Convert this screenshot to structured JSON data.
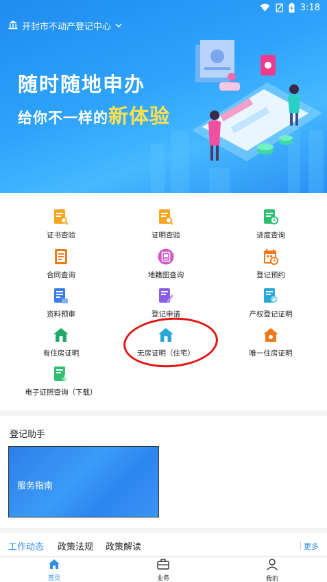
{
  "status_bar": {
    "time": "3:18",
    "icons": [
      "wifi-icon",
      "no-signal-icon",
      "battery-icon"
    ]
  },
  "header": {
    "location": "开封市不动产登记中心"
  },
  "banner": {
    "title_line1": "随时随地申办",
    "title_line2_prefix": "给你不一样的",
    "title_line2_highlight": "新体验"
  },
  "services": [
    {
      "label": "证书查验",
      "icon": "certificate-verify-icon",
      "color": "#f5a623"
    },
    {
      "label": "证明查验",
      "icon": "proof-verify-icon",
      "color": "#f5a623"
    },
    {
      "label": "进度查询",
      "icon": "progress-query-icon",
      "color": "#2fbf71"
    },
    {
      "label": "合同查询",
      "icon": "contract-query-icon",
      "color": "#f07a1b"
    },
    {
      "label": "地籍图查询",
      "icon": "cadastral-map-icon",
      "color": "#d05ac8"
    },
    {
      "label": "登记预约",
      "icon": "appointment-calendar-icon",
      "color": "#f07a1b"
    },
    {
      "label": "资料预审",
      "icon": "document-precheck-icon",
      "color": "#3a7de8"
    },
    {
      "label": "登记申请",
      "icon": "registration-apply-icon",
      "color": "#8a5ce6"
    },
    {
      "label": "产权登记证明",
      "icon": "property-proof-icon",
      "color": "#2aa6d8"
    },
    {
      "label": "有住房证明",
      "icon": "house-icon",
      "color": "#23a86b"
    },
    {
      "label": "无房证明（住宅）",
      "icon": "house-icon",
      "color": "#2aa6d8"
    },
    {
      "label": "唯一住房证明",
      "icon": "house-icon",
      "color": "#f07a1b"
    },
    {
      "label": "电子证照查询（下载）",
      "icon": "e-license-icon",
      "color": "#2fbf71"
    }
  ],
  "assistant": {
    "title": "登记助手",
    "card_label": "服务指南"
  },
  "news": {
    "tabs": [
      "工作动态",
      "政策法规",
      "政策解读"
    ],
    "more": "更多"
  },
  "bottom_nav": [
    {
      "label": "首页",
      "icon": "home-icon"
    },
    {
      "label": "业务",
      "icon": "briefcase-icon"
    },
    {
      "label": "我的",
      "icon": "user-icon"
    }
  ],
  "colors": {
    "accent": "#2f8de8",
    "annotation": "#e01515"
  }
}
